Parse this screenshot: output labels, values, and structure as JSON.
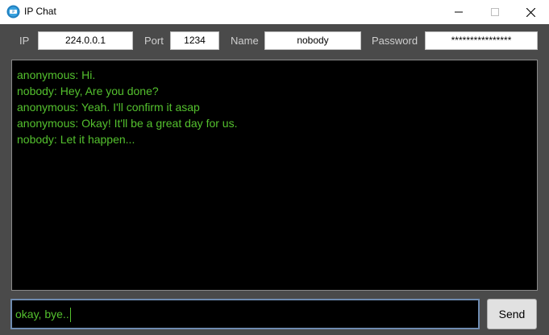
{
  "window": {
    "title": "IP Chat",
    "controls": {
      "minimize_icon": "minimize-icon",
      "maximize_icon": "maximize-icon",
      "close_icon": "close-icon"
    }
  },
  "settings": {
    "ip_label": "IP",
    "ip_value": "224.0.0.1",
    "port_label": "Port",
    "port_value": "1234",
    "name_label": "Name",
    "name_value": "nobody",
    "password_label": "Password",
    "password_value": "****************"
  },
  "chat": {
    "messages": [
      "anonymous: Hi.",
      "nobody: Hey, Are you done?",
      "anonymous: Yeah. I'll confirm it asap",
      "anonymous: Okay! It'll be a great day for us.",
      "nobody: Let it happen..."
    ]
  },
  "composer": {
    "input_value": "okay, bye..",
    "send_label": "Send"
  },
  "colors": {
    "chat_text": "#54c12e",
    "window_bg": "#4a4a4a",
    "chat_bg": "#000000",
    "input_border": "#6f8bb0"
  }
}
